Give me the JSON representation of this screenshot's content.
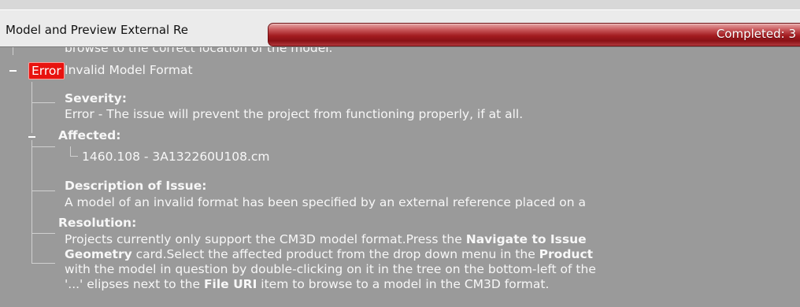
{
  "header": {
    "title": "Model and Preview External Re",
    "progress_label": "Completed: 3"
  },
  "tree": {
    "clipped_line": "browse to the correct location of the model.",
    "error_badge": "Error",
    "error_title": "Invalid Model Format",
    "severity_label": "Severity:",
    "severity_text": "Error - The issue will prevent the project from functioning properly, if at all.",
    "affected_label": "Affected:",
    "affected_item": "1460.108 - 3A132260U108.cm",
    "description_label": "Description of Issue:",
    "description_text": "A model of an invalid format has been specified by an external reference placed on a",
    "resolution_label": "Resolution:",
    "resolution_lines": [
      {
        "a": "Projects currently only support the CM3D model format.Press the ",
        "b": "Navigate to Issue",
        "c": ""
      },
      {
        "a": "",
        "b": "Geometry",
        "c": " card.Select the affected product from the drop down menu in the ",
        "d": "Product"
      },
      {
        "a": "with the model in question by double-clicking on it in the tree on the bottom-left of the",
        "b": "",
        "c": ""
      },
      {
        "a": "'...' elipses next to the ",
        "b": "File URI",
        "c": " item to browse to a model in the CM3D format."
      }
    ]
  },
  "colors": {
    "background": "#9a9a9a",
    "header": "#ebebeb",
    "progress": "#a31c20",
    "error_badge": "#e8130f",
    "text": "#f7f7f7"
  }
}
